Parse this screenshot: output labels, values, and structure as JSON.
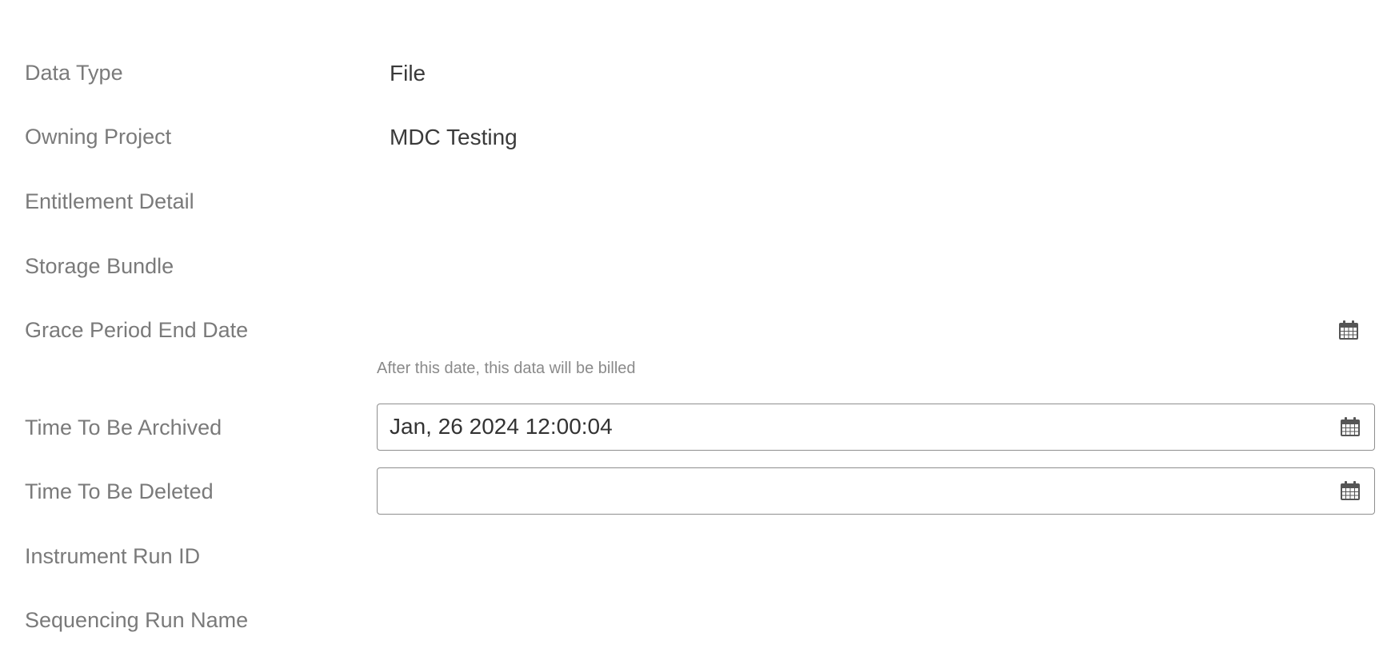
{
  "fields": {
    "data_type": {
      "label": "Data Type",
      "value": "File"
    },
    "owning_project": {
      "label": "Owning Project",
      "value": "MDC Testing"
    },
    "entitlement_detail": {
      "label": "Entitlement Detail"
    },
    "storage_bundle": {
      "label": "Storage Bundle"
    },
    "grace_period_end_date": {
      "label": "Grace Period End Date",
      "help": "After this date, this data will be billed"
    },
    "time_to_be_archived": {
      "label": "Time To Be Archived",
      "value": "Jan, 26 2024 12:00:04"
    },
    "time_to_be_deleted": {
      "label": "Time To Be Deleted",
      "value": ""
    },
    "instrument_run_id": {
      "label": "Instrument Run ID"
    },
    "sequencing_run_name": {
      "label": "Sequencing Run Name"
    }
  },
  "icons": {
    "calendar": "calendar-icon"
  },
  "colors": {
    "label": "#7a7a7a",
    "value": "#3a3a3a",
    "help": "#8a8a8a",
    "input_border": "#8e8e8e",
    "icon": "#555555"
  }
}
